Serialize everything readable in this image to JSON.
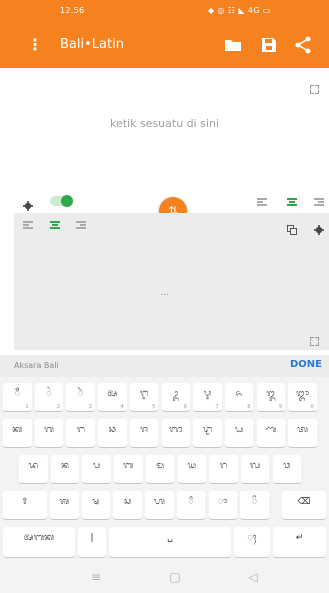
{
  "status_bar": {
    "time": "12.56",
    "right_text": "◆ ◎ ☷ ◣ 4G ▭"
  },
  "app_bar": {
    "menu_icon": "⋮",
    "title": "Bali•Latin",
    "accent": "#f5821f"
  },
  "editor": {
    "placeholder": "ketik sesuatu di sini"
  },
  "output": {
    "ellipsis": "..."
  },
  "swap": {
    "icon": "⇅"
  },
  "keyboard": {
    "label": "Aksara Bali",
    "done": "DONE",
    "rows": [
      [
        {
          "g": "ᬁ",
          "n": "1"
        },
        {
          "g": "ᬂ",
          "n": "2"
        },
        {
          "g": "ᬃ",
          "n": "3"
        },
        {
          "g": "ᬅ",
          "n": "4"
        },
        {
          "g": "ᬇ",
          "n": "5"
        },
        {
          "g": "ᬉ",
          "n": "6"
        },
        {
          "g": "ᬋ",
          "n": "7"
        },
        {
          "g": "ᬏ",
          "n": "8"
        },
        {
          "g": "ᬑ",
          "n": "9"
        },
        {
          "g": "ᬒ",
          "n": "0"
        }
      ],
      [
        {
          "g": "ᬓ",
          "n": ""
        },
        {
          "g": "ᬕ",
          "n": ""
        },
        {
          "g": "ᬗ",
          "n": ""
        },
        {
          "g": "ᬘ",
          "n": ""
        },
        {
          "g": "ᬚ",
          "n": ""
        },
        {
          "g": "ᬜ",
          "n": ""
        },
        {
          "g": "ᬝ",
          "n": ""
        },
        {
          "g": "ᬟ",
          "n": ""
        },
        {
          "g": "ᬡ",
          "n": ""
        },
        {
          "g": "ᬢ",
          "n": ""
        }
      ],
      [
        {
          "g": "ᬤ",
          "n": ""
        },
        {
          "g": "ᬦ",
          "n": ""
        },
        {
          "g": "ᬧ",
          "n": ""
        },
        {
          "g": "ᬩ",
          "n": ""
        },
        {
          "g": "ᬫ",
          "n": ""
        },
        {
          "g": "ᬬ",
          "n": ""
        },
        {
          "g": "ᬭ",
          "n": ""
        },
        {
          "g": "ᬮ",
          "n": ""
        },
        {
          "g": "ᬯ",
          "n": ""
        }
      ],
      [
        {
          "g": "ᬰ",
          "n": ""
        },
        {
          "g": "ᬱ",
          "n": ""
        },
        {
          "g": "ᬲ",
          "n": ""
        },
        {
          "g": "ᬳ",
          "n": ""
        },
        {
          "g": "᬴",
          "n": ""
        },
        {
          "g": "ᬵ",
          "n": ""
        },
        {
          "g": "ᬶ",
          "n": ""
        }
      ],
      {
        "abc": "ᬅᬩᬓ",
        "pipe": "|",
        "space": "␣",
        "punct": "ᬄ",
        "enter": "↵",
        "shift": "⇧",
        "backspace": "⌫"
      }
    ]
  },
  "nav": {
    "recent": "≡",
    "home": "▢",
    "back": "◁"
  }
}
